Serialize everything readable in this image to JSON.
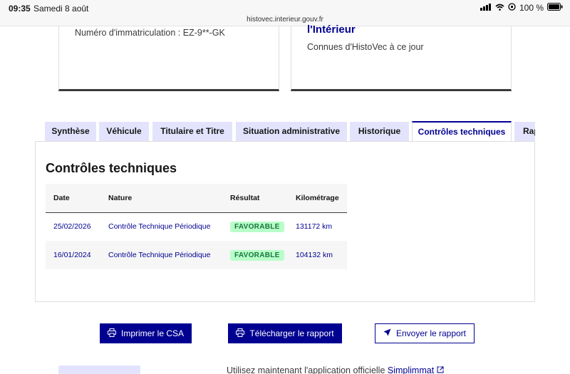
{
  "status_bar": {
    "time": "09:35",
    "date": "Samedi 8 août",
    "battery": "100 %"
  },
  "browser": {
    "url": "histovec.interieur.gouv.fr"
  },
  "cards": {
    "registration_text": "Numéro d'immatriculation : EZ-9**-GK",
    "ministry_title": "l'Intérieur",
    "ministry_text": "Connues d'HistoVec à ce jour"
  },
  "tabs": [
    {
      "label": "Synthèse"
    },
    {
      "label": "Véhicule"
    },
    {
      "label": "Titulaire et Titre"
    },
    {
      "label": "Situation administrative"
    },
    {
      "label": "Historique"
    },
    {
      "label": "Contrôles techniques"
    },
    {
      "label": "Rapport"
    }
  ],
  "section": {
    "title": "Contrôles techniques",
    "columns": [
      "Date",
      "Nature",
      "Résultat",
      "Kilométrage"
    ],
    "rows": [
      {
        "date": "25/02/2026",
        "nature": "Contrôle Technique Périodique",
        "result": "FAVORABLE",
        "km": "131172 km"
      },
      {
        "date": "16/01/2024",
        "nature": "Contrôle Technique Périodique",
        "result": "FAVORABLE",
        "km": "104132 km"
      }
    ]
  },
  "actions": {
    "print": "Imprimer le CSA",
    "download": "Télécharger le rapport",
    "send": "Envoyer le rapport"
  },
  "footer": {
    "text": "Utilisez maintenant l'application officielle ",
    "link": "Simplimmat"
  },
  "colors": {
    "primary": "#000091",
    "tab_bg": "#e3e3fd",
    "success_bg": "#b8fec9",
    "success_text": "#18753c"
  }
}
